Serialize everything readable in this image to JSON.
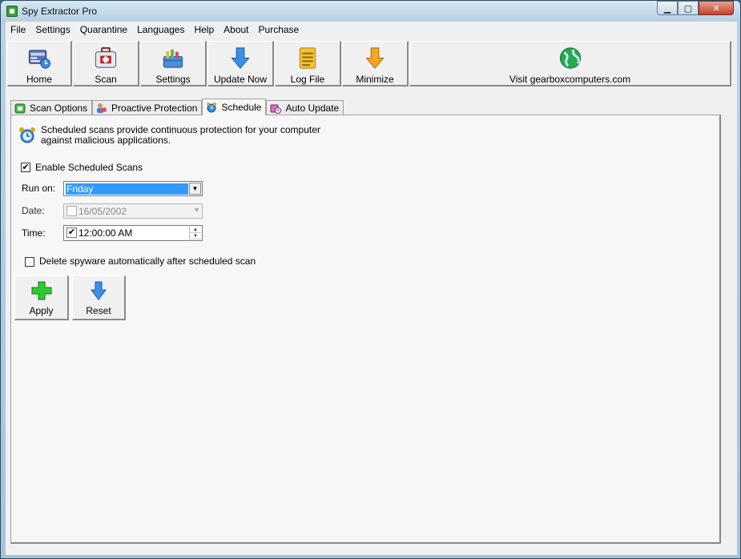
{
  "window": {
    "title": "Spy Extractor Pro"
  },
  "menu": [
    "File",
    "Settings",
    "Quarantine",
    "Languages",
    "Help",
    "About",
    "Purchase"
  ],
  "toolbar": {
    "home": "Home",
    "scan": "Scan",
    "settings": "Settings",
    "update_now": "Update Now",
    "log_file": "Log File",
    "minimize": "Minimize",
    "visit": "Visit gearboxcomputers.com"
  },
  "tabs": {
    "scan_options": "Scan Options",
    "proactive_protection": "Proactive Protection",
    "schedule": "Schedule",
    "auto_update": "Auto Update"
  },
  "schedule": {
    "info_line1": "Scheduled scans provide continuous protection for your computer",
    "info_line2": "against malicious applications.",
    "enable_label": "Enable Scheduled Scans",
    "enable_checked": "✔",
    "run_on_label": "Run on:",
    "run_on_value": "Friday",
    "date_label": "Date:",
    "date_value": "16/05/2002",
    "time_label": "Time:",
    "time_value": "12:00:00 AM",
    "time_checked": "✔",
    "delete_label": "Delete spyware automatically after scheduled scan",
    "apply": "Apply",
    "reset": "Reset"
  },
  "colors": {
    "accent": "#3399ff",
    "title_bar": "#b6cfe3",
    "close_button": "#c2412a"
  }
}
